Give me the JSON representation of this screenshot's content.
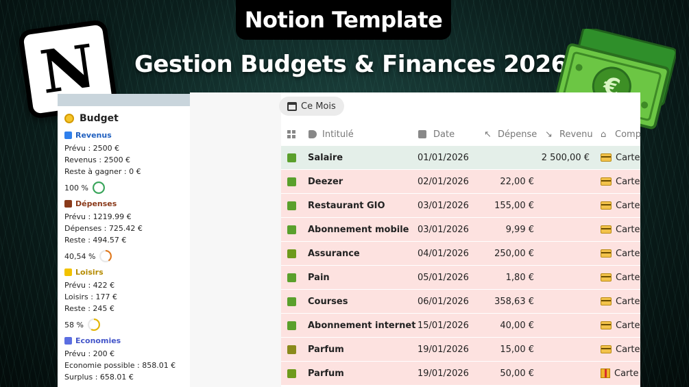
{
  "banner": {
    "title": "Notion Template",
    "subtitle": "Gestion Budgets & Finances 2026",
    "logo_letter": "N",
    "money_symbol": "€"
  },
  "sidebar": {
    "heading": "Budget",
    "sections": [
      {
        "name": "Revenus",
        "color": "#2f80ed",
        "text_color": "#1f5fbf",
        "lines": [
          "Prévu : 2500 €",
          "Revenus : 2500 €",
          "Reste à gagner : 0 €"
        ],
        "percent": "100 %",
        "ring_fraction": 1.0,
        "ring_color": "#3aa55b"
      },
      {
        "name": "Dépenses",
        "color": "#8a3a1a",
        "text_color": "#8a3a1a",
        "lines": [
          "Prévu : 1219.99 €",
          "Dépenses : 725.42 €",
          "Reste : 494.57 €"
        ],
        "percent": "40,54 %",
        "ring_fraction": 0.4054,
        "ring_color": "#e07a1f"
      },
      {
        "name": "Loisirs",
        "color": "#f2c200",
        "text_color": "#b58b00",
        "lines": [
          "Prévu : 422 €",
          "Loisirs : 177 €",
          "Reste : 245 €"
        ],
        "percent": "58 %",
        "ring_fraction": 0.58,
        "ring_color": "#e3b505"
      },
      {
        "name": "Economies",
        "color": "#5b6ee1",
        "text_color": "#4355c9",
        "lines": [
          "Prévu : 200 €",
          "Economie possible : 858.01 €",
          "Surplus : 658.01 €"
        ]
      }
    ]
  },
  "view": {
    "label": "Ce Mois",
    "icon": "calendar-icon"
  },
  "table": {
    "headers": {
      "name": "Intitulé",
      "date": "Date",
      "expense": "Dépense",
      "income": "Revenu",
      "account": "Comp"
    },
    "rows": [
      {
        "name": "Salaire",
        "date": "01/01/2026",
        "expense": "",
        "income": "2 500,00 €",
        "account": "Carte",
        "icon": "card",
        "bg": "#e4efe9",
        "chk": "#5aa02c"
      },
      {
        "name": "Deezer",
        "date": "02/01/2026",
        "expense": "22,00 €",
        "income": "",
        "account": "Carte",
        "icon": "card",
        "bg": "#fde2e0",
        "chk": "#5aa02c"
      },
      {
        "name": "Restaurant GIO",
        "date": "03/01/2026",
        "expense": "155,00 €",
        "income": "",
        "account": "Carte",
        "icon": "card",
        "bg": "#fde2e0",
        "chk": "#5aa02c"
      },
      {
        "name": "Abonnement mobile",
        "date": "03/01/2026",
        "expense": "9,99 €",
        "income": "",
        "account": "Carte",
        "icon": "card",
        "bg": "#fde2e0",
        "chk": "#5aa02c"
      },
      {
        "name": "Assurance",
        "date": "04/01/2026",
        "expense": "250,00 €",
        "income": "",
        "account": "Carte",
        "icon": "card",
        "bg": "#fde2e0",
        "chk": "#6e9a1c"
      },
      {
        "name": "Pain",
        "date": "05/01/2026",
        "expense": "1,80 €",
        "income": "",
        "account": "Carte",
        "icon": "card",
        "bg": "#fde2e0",
        "chk": "#5aa02c"
      },
      {
        "name": "Courses",
        "date": "06/01/2026",
        "expense": "358,63 €",
        "income": "",
        "account": "Carte",
        "icon": "card",
        "bg": "#fde2e0",
        "chk": "#5aa02c"
      },
      {
        "name": "Abonnement internet",
        "date": "15/01/2026",
        "expense": "40,00 €",
        "income": "",
        "account": "Carte",
        "icon": "card",
        "bg": "#fde2e0",
        "chk": "#5aa02c"
      },
      {
        "name": "Parfum",
        "date": "19/01/2026",
        "expense": "15,00 €",
        "income": "",
        "account": "Carte",
        "icon": "card",
        "bg": "#fde2e0",
        "chk": "#8a8a1c"
      },
      {
        "name": "Parfum",
        "date": "19/01/2026",
        "expense": "50,00 €",
        "income": "",
        "account": "Carte",
        "icon": "gift",
        "bg": "#fde2e0",
        "chk": "#6e9a1c"
      }
    ]
  }
}
